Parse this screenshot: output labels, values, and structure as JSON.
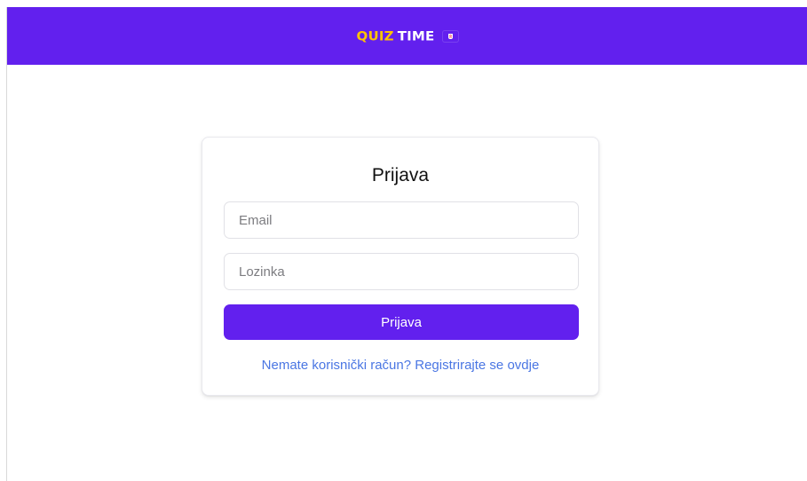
{
  "header": {
    "brand_quiz": "QUIZ",
    "brand_time": "TIME",
    "flag_icon": "croatian-flag-icon",
    "background_color": "#6220ee",
    "brand_quiz_color": "#ffc400",
    "brand_time_color": "#ffffff"
  },
  "login": {
    "title": "Prijava",
    "email_placeholder": "Email",
    "email_value": "",
    "password_placeholder": "Lozinka",
    "password_value": "",
    "button_label": "Prijava",
    "register_link": "Nemate korisnički račun? Registrirajte se ovdje",
    "button_color": "#6220ee",
    "link_color": "#4a76e3"
  }
}
